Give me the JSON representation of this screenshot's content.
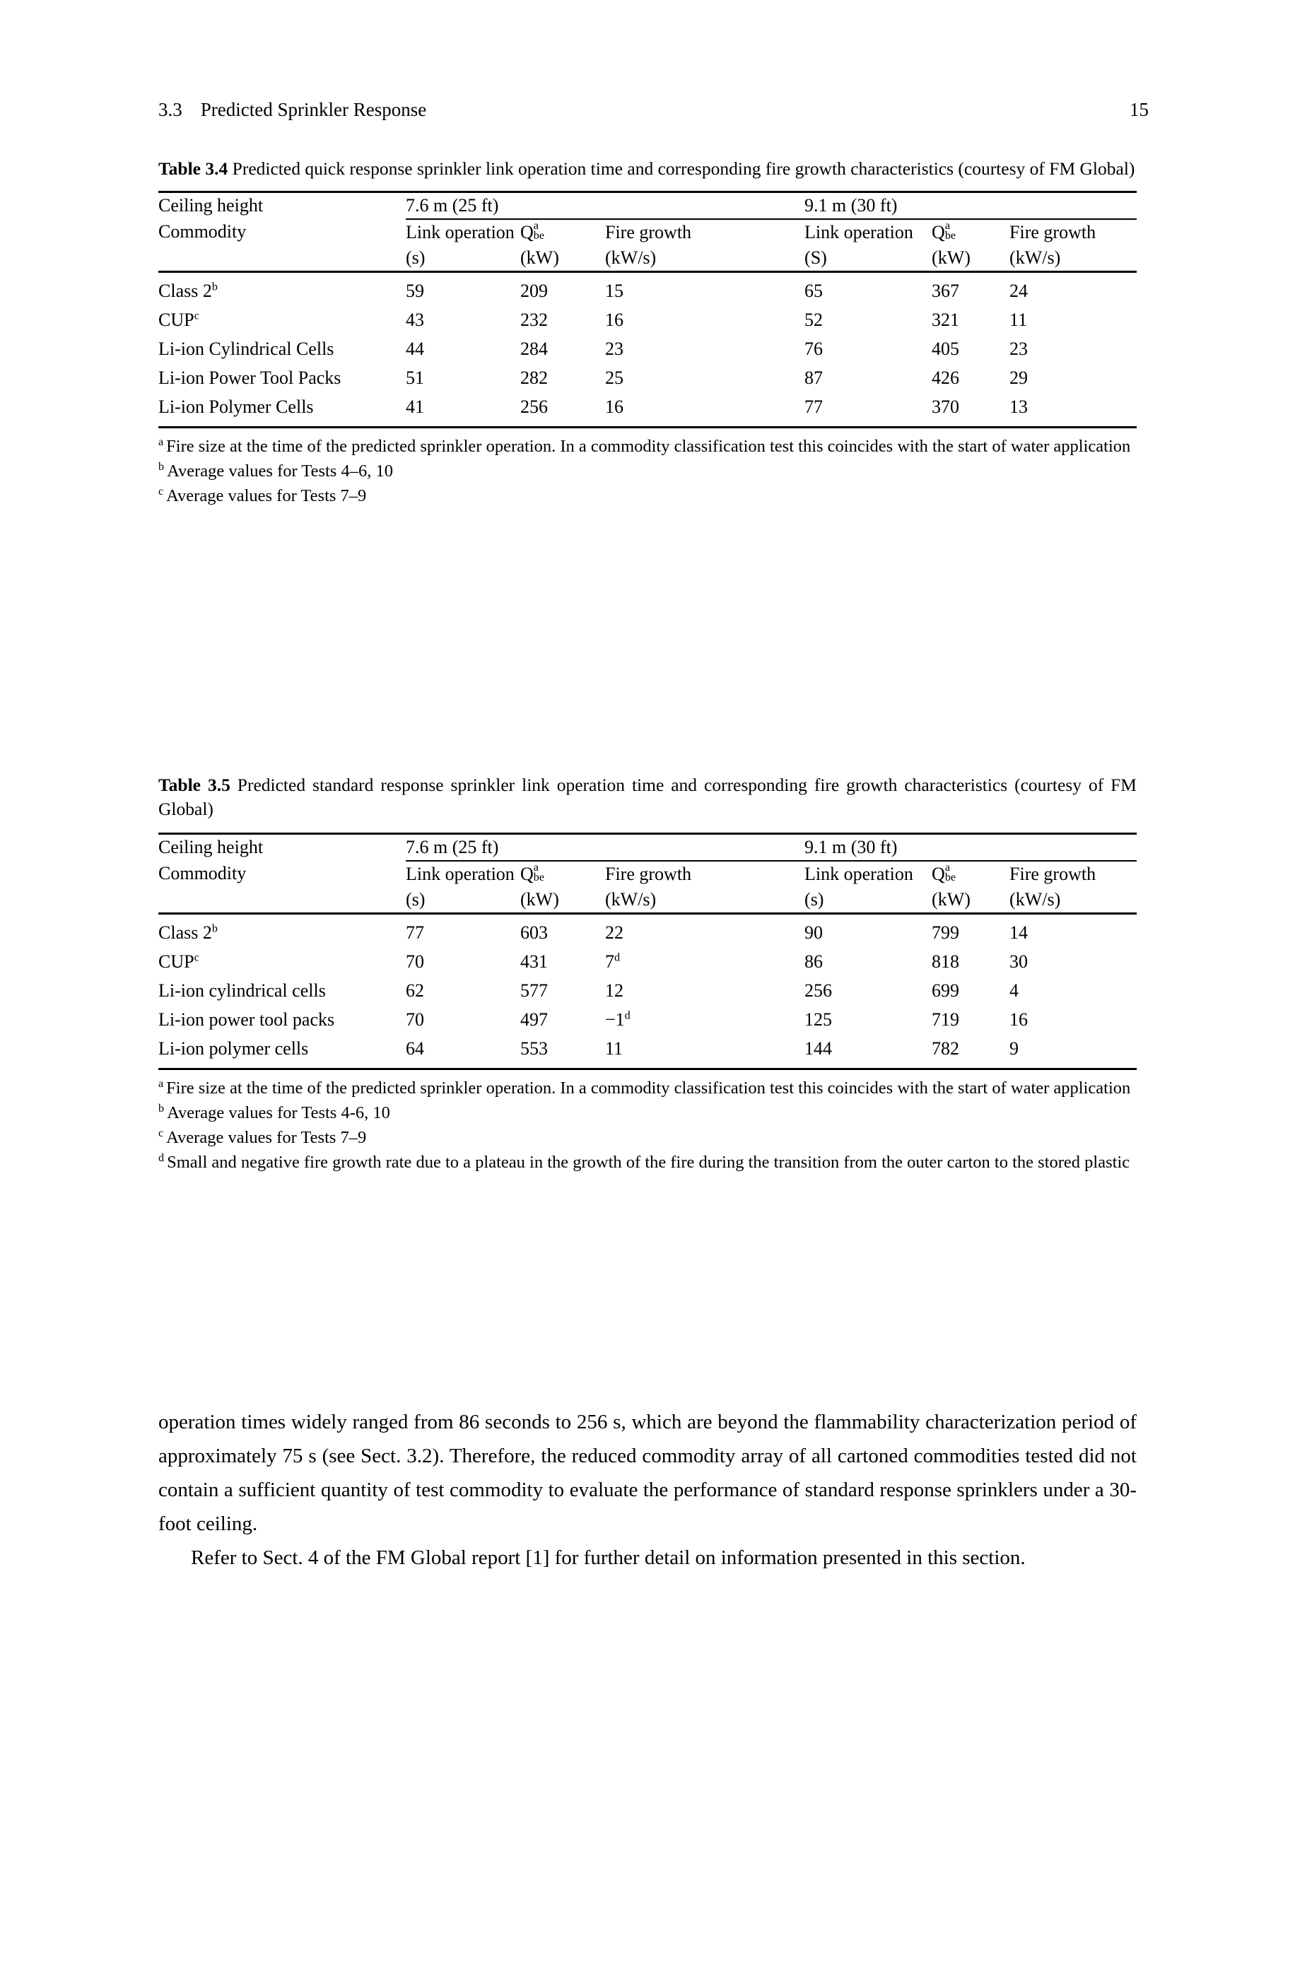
{
  "running_head": {
    "section_number": "3.3",
    "section_title": "Predicted Sprinkler Response",
    "page_number": "15"
  },
  "table_3_4": {
    "caption_label": "Table 3.4",
    "caption_text": "Predicted quick response sprinkler link operation time and corresponding fire growth characteristics (courtesy of FM Global)",
    "stub_header_1": "Ceiling height",
    "stub_header_2": "Commodity",
    "group_headers": [
      "7.6 m (25 ft)",
      "9.1 m (30 ft)"
    ],
    "column_headers": {
      "link_operation": "Link operation",
      "link_operation_unit_left": "(s)",
      "link_operation_unit_right": "(S)",
      "q_symbol": "Q",
      "q_superscript": "a",
      "q_subscript": "be",
      "q_unit": "(kW)",
      "fire_growth": "Fire growth",
      "fire_growth_unit": "(kW/s)"
    },
    "rows": [
      {
        "commodity": "Class 2",
        "commodity_mark": "b",
        "link_25": "59",
        "q_25": "209",
        "growth_25": "15",
        "link_30": "65",
        "q_30": "367",
        "growth_30": "24"
      },
      {
        "commodity": "CUP",
        "commodity_mark": "c",
        "link_25": "43",
        "q_25": "232",
        "growth_25": "16",
        "link_30": "52",
        "q_30": "321",
        "growth_30": "11"
      },
      {
        "commodity": "Li-ion Cylindrical Cells",
        "commodity_mark": "",
        "link_25": "44",
        "q_25": "284",
        "growth_25": "23",
        "link_30": "76",
        "q_30": "405",
        "growth_30": "23"
      },
      {
        "commodity": "Li-ion Power Tool Packs",
        "commodity_mark": "",
        "link_25": "51",
        "q_25": "282",
        "growth_25": "25",
        "link_30": "87",
        "q_30": "426",
        "growth_30": "29"
      },
      {
        "commodity": "Li-ion Polymer Cells",
        "commodity_mark": "",
        "link_25": "41",
        "q_25": "256",
        "growth_25": "16",
        "link_30": "77",
        "q_30": "370",
        "growth_30": "13"
      }
    ],
    "footnotes": [
      {
        "mark": "a",
        "text": "Fire size at the time of the predicted sprinkler operation. In a commodity classification test this coincides with the start of water application"
      },
      {
        "mark": "b",
        "text": "Average values for Tests 4–6, 10"
      },
      {
        "mark": "c",
        "text": "Average values for Tests 7–9"
      }
    ]
  },
  "table_3_5": {
    "caption_label": "Table 3.5",
    "caption_text": "Predicted standard response sprinkler link operation time and corresponding fire growth characteristics (courtesy of FM Global)",
    "stub_header_1": "Ceiling height",
    "stub_header_2": "Commodity",
    "group_headers": [
      "7.6 m (25 ft)",
      "9.1 m (30 ft)"
    ],
    "column_headers": {
      "link_operation": "Link operation",
      "link_operation_unit_left": "(s)",
      "link_operation_unit_right": "(s)",
      "q_symbol": "Q",
      "q_superscript": "a",
      "q_subscript": "be",
      "q_unit": "(kW)",
      "fire_growth": "Fire growth",
      "fire_growth_unit": "(kW/s)"
    },
    "rows": [
      {
        "commodity": "Class 2",
        "commodity_mark": "b",
        "link_25": "77",
        "q_25": "603",
        "growth_25": "22",
        "growth_25_mark": "",
        "link_30": "90",
        "q_30": "799",
        "growth_30": "14"
      },
      {
        "commodity": "CUP",
        "commodity_mark": "c",
        "link_25": "70",
        "q_25": "431",
        "growth_25": "7",
        "growth_25_mark": "d",
        "link_30": "86",
        "q_30": "818",
        "growth_30": "30"
      },
      {
        "commodity": "Li-ion cylindrical cells",
        "commodity_mark": "",
        "link_25": "62",
        "q_25": "577",
        "growth_25": "12",
        "growth_25_mark": "",
        "link_30": "256",
        "q_30": "699",
        "growth_30": "4"
      },
      {
        "commodity": "Li-ion power tool packs",
        "commodity_mark": "",
        "link_25": "70",
        "q_25": "497",
        "growth_25": "−1",
        "growth_25_mark": "d",
        "link_30": "125",
        "q_30": "719",
        "growth_30": "16"
      },
      {
        "commodity": "Li-ion polymer cells",
        "commodity_mark": "",
        "link_25": "64",
        "q_25": "553",
        "growth_25": "11",
        "growth_25_mark": "",
        "link_30": "144",
        "q_30": "782",
        "growth_30": "9"
      }
    ],
    "footnotes": [
      {
        "mark": "a",
        "text": "Fire size at the time of the predicted sprinkler operation. In a commodity classification test this coincides with the start of water application"
      },
      {
        "mark": "b",
        "text": "Average values for Tests 4-6, 10"
      },
      {
        "mark": "c",
        "text": "Average values for Tests 7–9"
      },
      {
        "mark": "d",
        "text": "Small and negative fire growth rate due to a plateau in the growth of the fire during the transition from the outer carton to the stored plastic"
      }
    ]
  },
  "body": {
    "paragraph_1": "operation times widely ranged from 86 seconds to 256 s, which are beyond the flammability characterization period of approximately 75 s (see Sect. 3.2). Therefore, the reduced commodity array of all cartoned commodities tested did not contain a sufficient quantity of test commodity to evaluate the performance of standard response sprinklers under a 30-foot ceiling.",
    "paragraph_2": "Refer to Sect. 4 of the FM Global report [1] for further detail on information presented in this section."
  }
}
